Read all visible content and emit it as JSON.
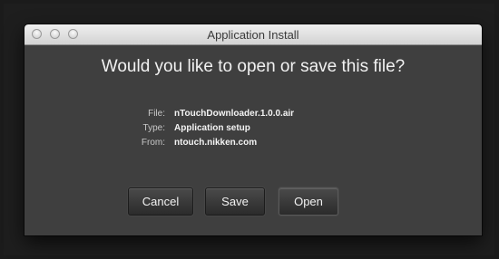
{
  "window": {
    "title": "Application Install"
  },
  "dialog": {
    "question": "Would you like to open or save this file?",
    "details": [
      {
        "label": "File:",
        "value": "nTouchDownloader.1.0.0.air"
      },
      {
        "label": "Type:",
        "value": "Application setup"
      },
      {
        "label": "From:",
        "value": "ntouch.nikken.com"
      }
    ]
  },
  "buttons": {
    "cancel": "Cancel",
    "save": "Save",
    "open": "Open"
  }
}
